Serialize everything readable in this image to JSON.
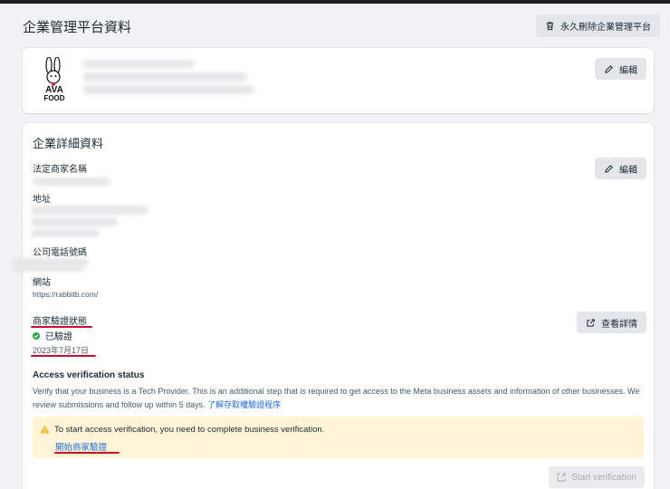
{
  "header": {
    "title": "企業管理平台資料",
    "delete_label": "永久刪除企業管理平台"
  },
  "profile": {
    "logo_text": "AVA FOOD",
    "edit_label": "編輯"
  },
  "details": {
    "title": "企業詳細資料",
    "edit_label": "編輯",
    "legal_name_label": "法定商家名稱",
    "address_label": "地址",
    "phone_label": "公司電話號碼",
    "website_label": "網站",
    "website_value": "https://rabbitb.com/",
    "verification_label": "商家驗證狀態",
    "verification_status": "已驗證",
    "verification_date": "2023年7月17日",
    "view_details_label": "查看詳情",
    "access_title": "Access verification status",
    "access_desc": "Verify that your business is a Tech Provider. This is an additional step that is required to get access to the Meta business assets and information of other businesses. We review submissions and follow up within 5 days.",
    "access_link": "了解存取權驗證程序",
    "alert_text": "To start access verification, you need to complete business verification.",
    "alert_link": "開始商家驗證",
    "start_verification_label": "Start verification"
  },
  "colors": {
    "accent_link": "#216fdb",
    "success": "#31a24c",
    "warning_bg": "#fff4d6",
    "annotation_red": "#c8102e"
  }
}
